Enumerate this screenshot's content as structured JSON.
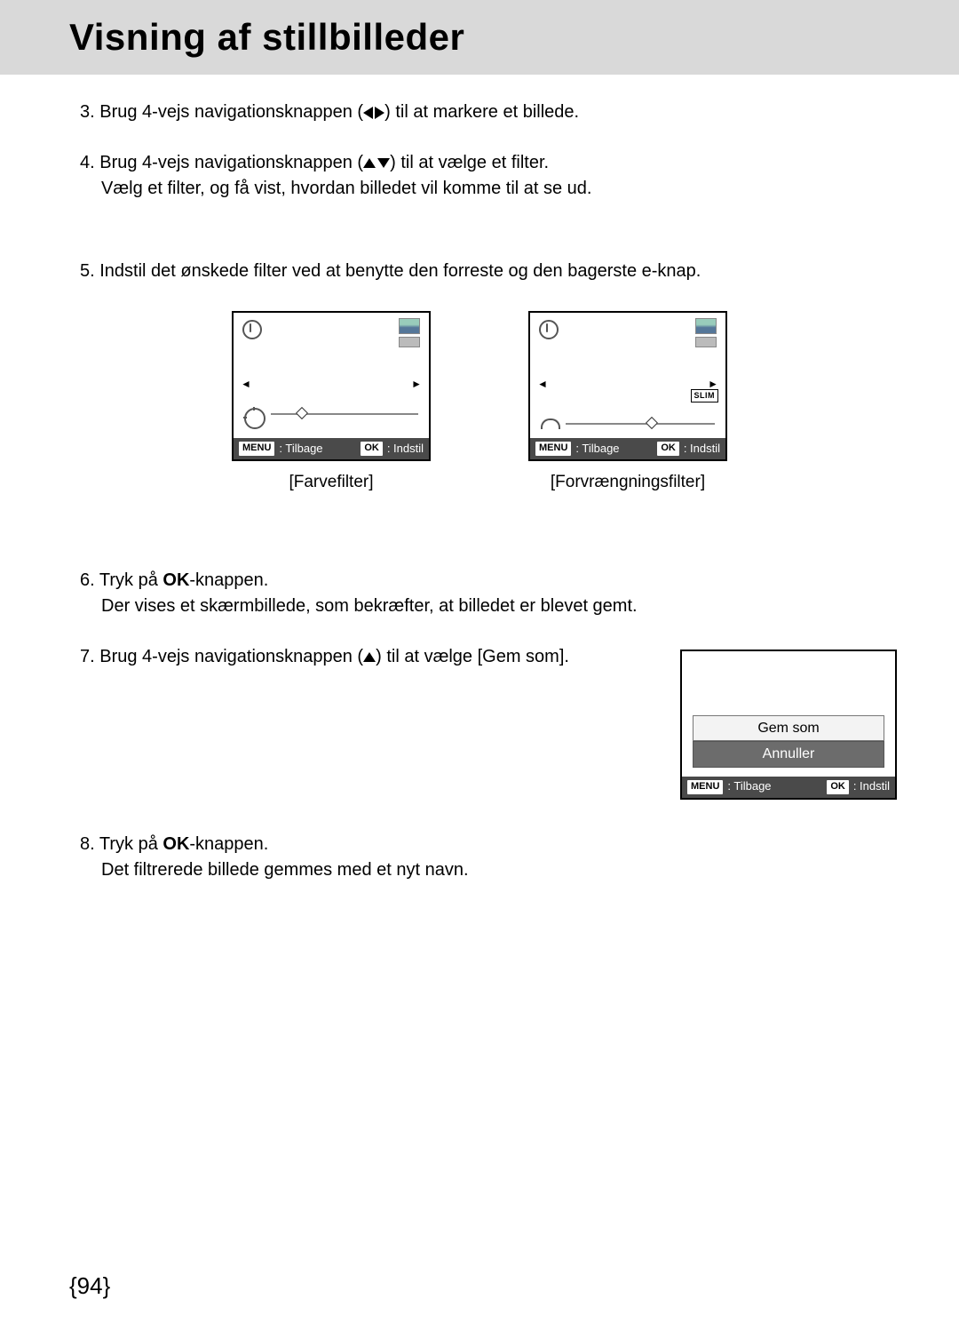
{
  "header": {
    "title": "Visning af stillbilleder"
  },
  "steps": {
    "s3": {
      "num": "3.",
      "text_a": "Brug 4-vejs navigationsknappen (",
      "text_b": ") til at markere et billede."
    },
    "s4": {
      "num": "4.",
      "text_a": "Brug 4-vejs navigationsknappen (",
      "text_b": ") til at vælge et filter.",
      "sub": "Vælg et filter, og få vist, hvordan billedet vil komme til at se ud."
    },
    "s5": {
      "num": "5.",
      "text": "Indstil det ønskede filter ved at benytte den forreste og den bagerste e-knap."
    },
    "s6": {
      "num": "6.",
      "text_a": "Tryk på ",
      "bold": "OK",
      "text_b": "-knappen.",
      "sub": "Der vises et skærmbillede, som bekræfter, at billedet er blevet gemt."
    },
    "s7": {
      "num": "7.",
      "text_a": "Brug 4-vejs navigationsknappen (",
      "text_b": ") til at vælge [Gem som]."
    },
    "s8": {
      "num": "8.",
      "text_a": "Tryk på ",
      "bold": "OK",
      "text_b": "-knappen.",
      "sub": "Det filtrerede billede gemmes med et nyt navn."
    }
  },
  "screens": {
    "left_caption": "[Farvefilter]",
    "right_caption": "[Forvrængningsfilter]",
    "slim": "SLIM",
    "status": {
      "menu": "MENU",
      "menu_txt": ": Tilbage",
      "ok": "OK",
      "ok_txt": ": Indstil"
    }
  },
  "save": {
    "opt1": "Gem som",
    "opt2": "Annuller"
  },
  "page": "{94}"
}
